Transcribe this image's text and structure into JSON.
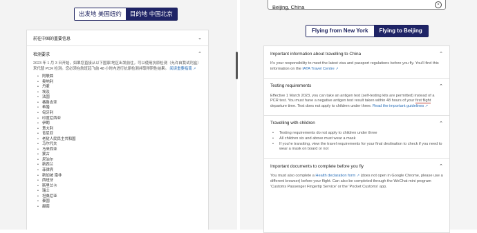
{
  "left": {
    "toggle": {
      "from": "出发地 美国纽约",
      "to": "目的地 中国北京"
    },
    "sections": [
      {
        "title": "前往中国的重要信息",
        "expanded": false
      },
      {
        "title": "检测要求",
        "expanded": true,
        "body": "2023 年 1 月 3 日开始，如果您直接从以下国家/地区出发前往，可以使用抗原检测（允许自我试剂盒）来代替 PCR 检测。您必须在航班起飞前 48 小时内进行抗原检测并取得阴性结果。",
        "link": "阅读重要指南"
      }
    ],
    "countries": [
      "阿联酋",
      "奥地利",
      "丹麦",
      "埃及",
      "法国",
      "格鲁吉亚",
      "希腊",
      "匈牙利",
      "印度尼西亚",
      "伊朗",
      "意大利",
      "肯尼亚",
      "老挝人民民主共和国",
      "马尔代夫",
      "马来西亚",
      "蒙古",
      "尼泊尔",
      "新西兰",
      "菲律宾",
      "新加坡 南非",
      "西班牙",
      "斯里兰卡",
      "瑞士",
      "坦桑尼亚",
      "泰国",
      "越南"
    ]
  },
  "right": {
    "search": {
      "value": "Beijing, China"
    },
    "toggle": {
      "from": "Flying from New York",
      "to": "Flying to Beijing"
    },
    "sections": [
      {
        "title": "Important information about travelling to China",
        "body": "It's your responsibility to meet the latest visa and passport regulations before you fly. You'll find this information on the",
        "link": "IATA Travel Centre"
      },
      {
        "title": "Testing requirements",
        "body_a": "Effective 1 March 2023, you can take an antigen test (self-testing kits are permitted) instead of a PCR test. You must have a negative antigen test result taken within 48 hours of your",
        "underline": "first flight",
        "body_b": "departure time. Test does not apply to children under three.",
        "link": "Read the important guidelines"
      },
      {
        "title": "Travelling with children",
        "bullets": [
          "Testing requirements do not apply to children under three",
          "All children six and above must wear a mask",
          "If you're transiting, view the travel requirements for your final destination to check if you need to wear a mask on board or not"
        ]
      },
      {
        "title": "Important documents to complete before you fly",
        "body_a": "You must also complete a",
        "link": "Health declaration form",
        "body_b": "(does not open in Google Chrome, please use a different browser) before your flight. Can also be completed through the WeChat mini program 'Customs Passenger Fingertip Service' or the 'Pocket Customs' app."
      }
    ]
  },
  "icons": {
    "expand": "chevron-down-icon",
    "collapse": "chevron-up-icon",
    "external": "external-link-icon",
    "clear": "clear-icon"
  },
  "colors": {
    "navy": "#1f2466",
    "link": "#2a6fb8",
    "underline": "#c0392b"
  }
}
